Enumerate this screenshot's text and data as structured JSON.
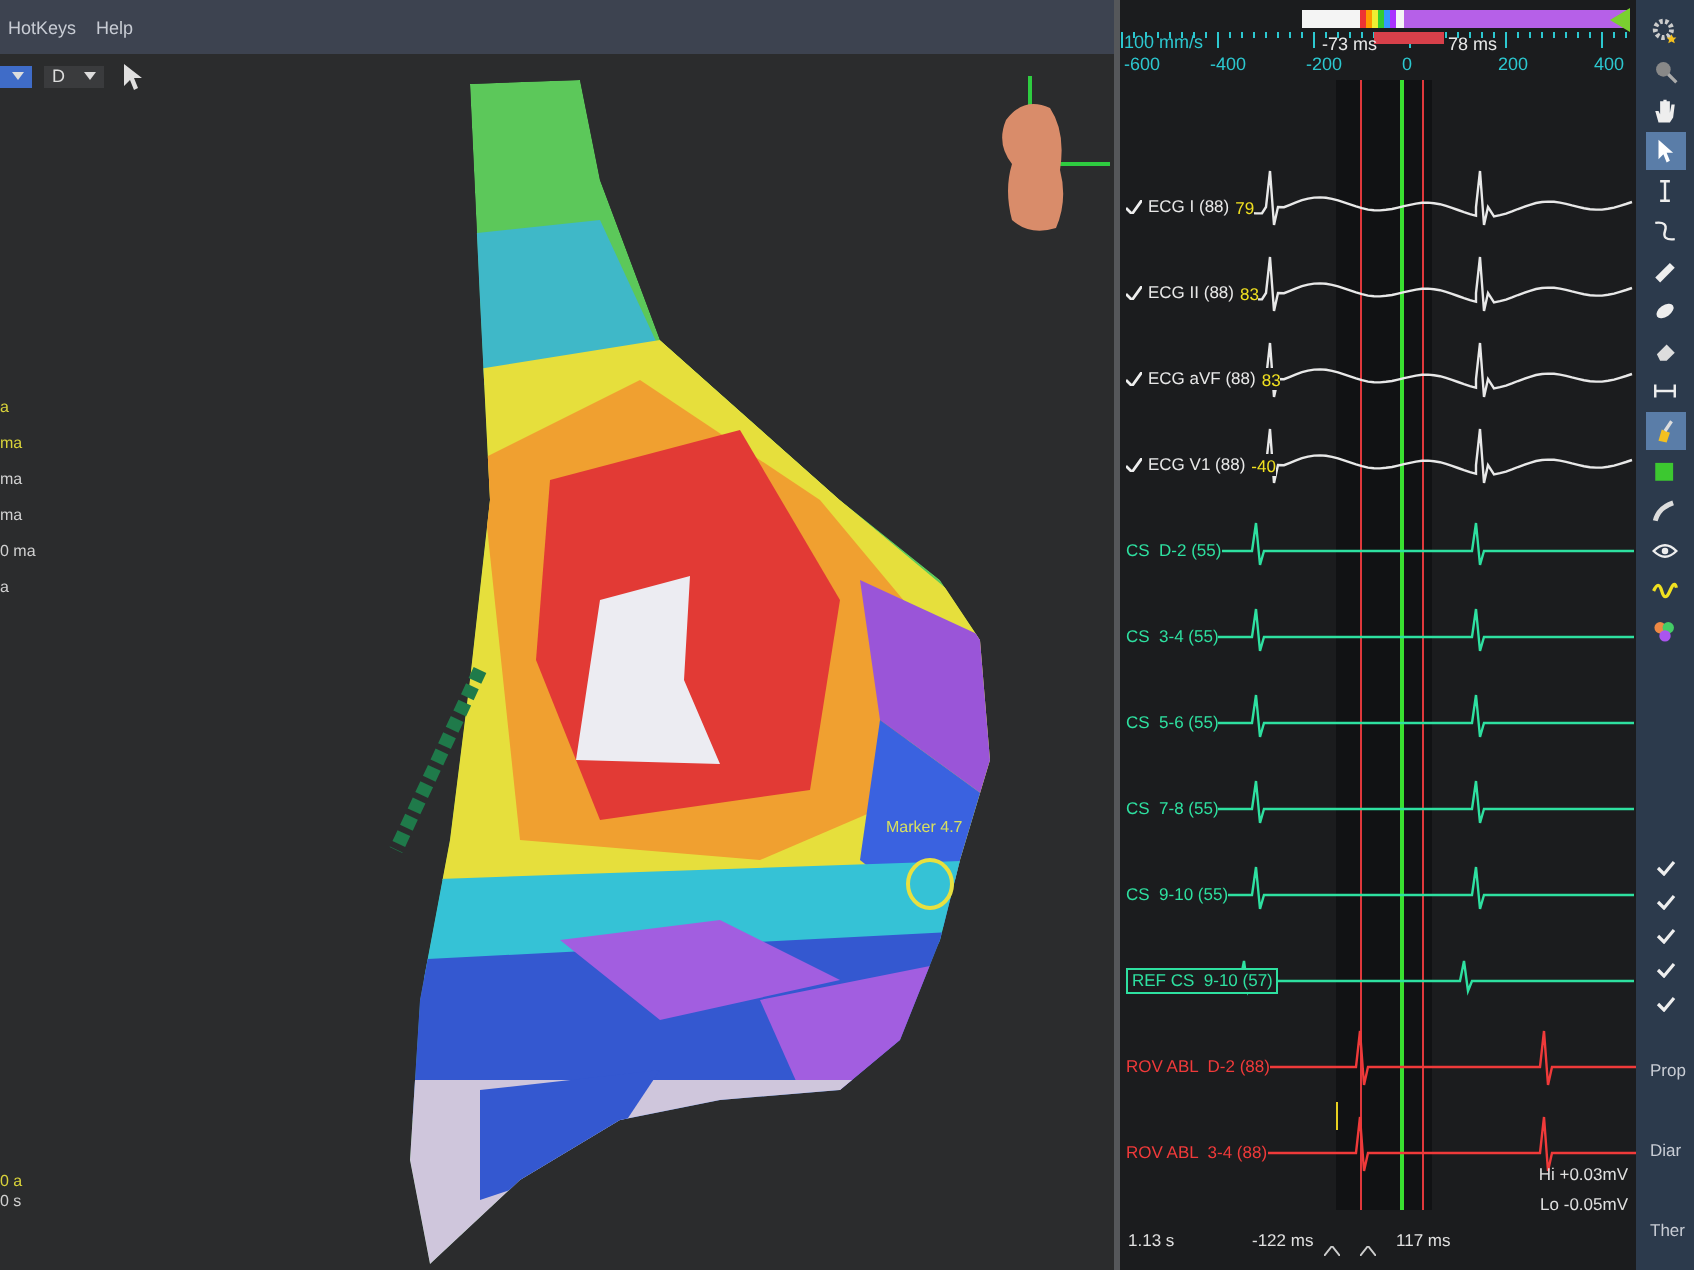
{
  "menu_bar": {
    "items": [
      "HotKeys",
      "Help"
    ]
  },
  "toolbar": {
    "dropdowns": [
      {
        "kind": "accent"
      },
      {
        "kind": "plain",
        "value": "D"
      }
    ]
  },
  "readouts_top": [
    {
      "text": "a",
      "color": "#d8d23a"
    },
    {
      "text": "ma",
      "color": "#d8d23a"
    },
    {
      "text": "ma",
      "color": "#d0d0d0"
    },
    {
      "text": "ma",
      "color": "#d0d0d0"
    },
    {
      "text": "0 ma",
      "color": "#d0d0d0"
    },
    {
      "text": "a",
      "color": "#d0d0d0"
    }
  ],
  "readouts_bottom": [
    {
      "text": "0 a",
      "color": "#d8d23a"
    },
    {
      "text": "0 s",
      "color": "#d0d0d0"
    }
  ],
  "map": {
    "marker_label": "Marker 4.7"
  },
  "ecg": {
    "scale": {
      "speed": "100 mm/s",
      "ticks": [
        "-600",
        "-400",
        "-200",
        "0",
        "200",
        "400"
      ],
      "cursor_left": "-73 ms",
      "cursor_right": "78 ms"
    },
    "channels": [
      {
        "kind": "ecg",
        "name": "ECG I (88)",
        "value": "79",
        "checked": true,
        "color": "#e8e8e8"
      },
      {
        "kind": "ecg",
        "name": "ECG II (88)",
        "value": "83",
        "checked": true,
        "color": "#e8e8e8"
      },
      {
        "kind": "ecg",
        "name": "ECG aVF (88)",
        "value": "83",
        "checked": true,
        "color": "#e8e8e8"
      },
      {
        "kind": "ecg",
        "name": "ECG V1 (88)",
        "value": "-40",
        "checked": true,
        "color": "#e8e8e8"
      },
      {
        "kind": "cs",
        "name": "CS  D-2 (55)",
        "color": "#2ee0a0"
      },
      {
        "kind": "cs",
        "name": "CS  3-4 (55)",
        "color": "#2ee0a0"
      },
      {
        "kind": "cs",
        "name": "CS  5-6 (55)",
        "color": "#2ee0a0"
      },
      {
        "kind": "cs",
        "name": "CS  7-8 (55)",
        "color": "#2ee0a0"
      },
      {
        "kind": "cs",
        "name": "CS  9-10 (55)",
        "color": "#2ee0a0"
      },
      {
        "kind": "ref",
        "name": "REF CS  9-10 (57)",
        "color": "#2ee0a0"
      },
      {
        "kind": "rov",
        "name": "ROV ABL  D-2 (88)",
        "color": "#f03a3a"
      },
      {
        "kind": "rov",
        "name": "ROV ABL  3-4 (88)",
        "color": "#f03a3a"
      }
    ],
    "gain": {
      "hi": "Hi +0.03mV",
      "lo": "Lo -0.05mV"
    },
    "footer": {
      "duration": "1.13 s",
      "left_time": "-122 ms",
      "right_time": "117 ms"
    }
  },
  "tools": [
    {
      "kind": "gear",
      "selected": false
    },
    {
      "kind": "magnifier",
      "selected": false
    },
    {
      "kind": "hand",
      "selected": false
    },
    {
      "kind": "pointer",
      "selected": true
    },
    {
      "kind": "text-cursor",
      "selected": false
    },
    {
      "kind": "curve",
      "selected": false
    },
    {
      "kind": "ruler",
      "selected": false
    },
    {
      "kind": "ellipse",
      "selected": false
    },
    {
      "kind": "eraser",
      "selected": false
    },
    {
      "kind": "caliper",
      "selected": false
    },
    {
      "kind": "brush",
      "selected": true
    },
    {
      "kind": "square",
      "selected": false
    },
    {
      "kind": "pen",
      "selected": false
    },
    {
      "kind": "eye",
      "selected": false
    },
    {
      "kind": "wave",
      "selected": false
    },
    {
      "kind": "palette",
      "selected": false
    }
  ],
  "checks": [
    {
      "checked": true
    },
    {
      "checked": true
    },
    {
      "checked": true
    },
    {
      "checked": true
    },
    {
      "checked": true
    }
  ],
  "side_labels": [
    "Prop",
    "Diar",
    "Ther"
  ]
}
